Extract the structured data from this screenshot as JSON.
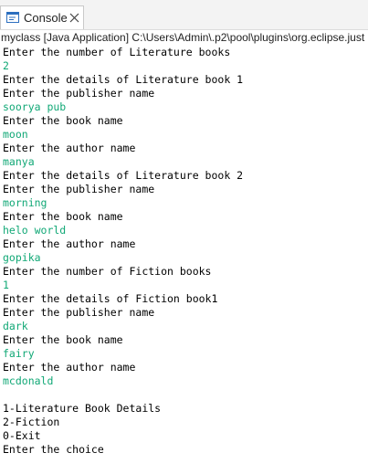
{
  "tab": {
    "label": "Console",
    "icon": "console-icon",
    "close_icon": "close-icon"
  },
  "launch_description": "myclass [Java Application] C:\\Users\\Admin\\.p2\\pool\\plugins\\org.eclipse.just",
  "colors": {
    "output_text": "#000000",
    "input_text": "#11a876",
    "icon_blue": "#2c6fbf"
  },
  "console": {
    "lines": [
      {
        "text": "Enter the number of Literature books",
        "kind": "out"
      },
      {
        "text": "2",
        "kind": "in"
      },
      {
        "text": "Enter the details of Literature book 1",
        "kind": "out"
      },
      {
        "text": "Enter the publisher name",
        "kind": "out"
      },
      {
        "text": "soorya pub",
        "kind": "in"
      },
      {
        "text": "Enter the book name",
        "kind": "out"
      },
      {
        "text": "moon",
        "kind": "in"
      },
      {
        "text": "Enter the author name",
        "kind": "out"
      },
      {
        "text": "manya",
        "kind": "in"
      },
      {
        "text": "Enter the details of Literature book 2",
        "kind": "out"
      },
      {
        "text": "Enter the publisher name",
        "kind": "out"
      },
      {
        "text": "morning",
        "kind": "in"
      },
      {
        "text": "Enter the book name",
        "kind": "out"
      },
      {
        "text": "helo world",
        "kind": "in"
      },
      {
        "text": "Enter the author name",
        "kind": "out"
      },
      {
        "text": "gopika",
        "kind": "in"
      },
      {
        "text": "Enter the number of Fiction books",
        "kind": "out"
      },
      {
        "text": "1",
        "kind": "in"
      },
      {
        "text": "Enter the details of Fiction book1",
        "kind": "out"
      },
      {
        "text": "Enter the publisher name",
        "kind": "out"
      },
      {
        "text": "dark",
        "kind": "in"
      },
      {
        "text": "Enter the book name",
        "kind": "out"
      },
      {
        "text": "fairy",
        "kind": "in"
      },
      {
        "text": "Enter the author name",
        "kind": "out"
      },
      {
        "text": "mcdonald",
        "kind": "in"
      },
      {
        "text": "",
        "kind": "out"
      },
      {
        "text": "1-Literature Book Details",
        "kind": "out"
      },
      {
        "text": "2-Fiction",
        "kind": "out"
      },
      {
        "text": "0-Exit",
        "kind": "out"
      },
      {
        "text": "Enter the choice",
        "kind": "out"
      }
    ]
  }
}
